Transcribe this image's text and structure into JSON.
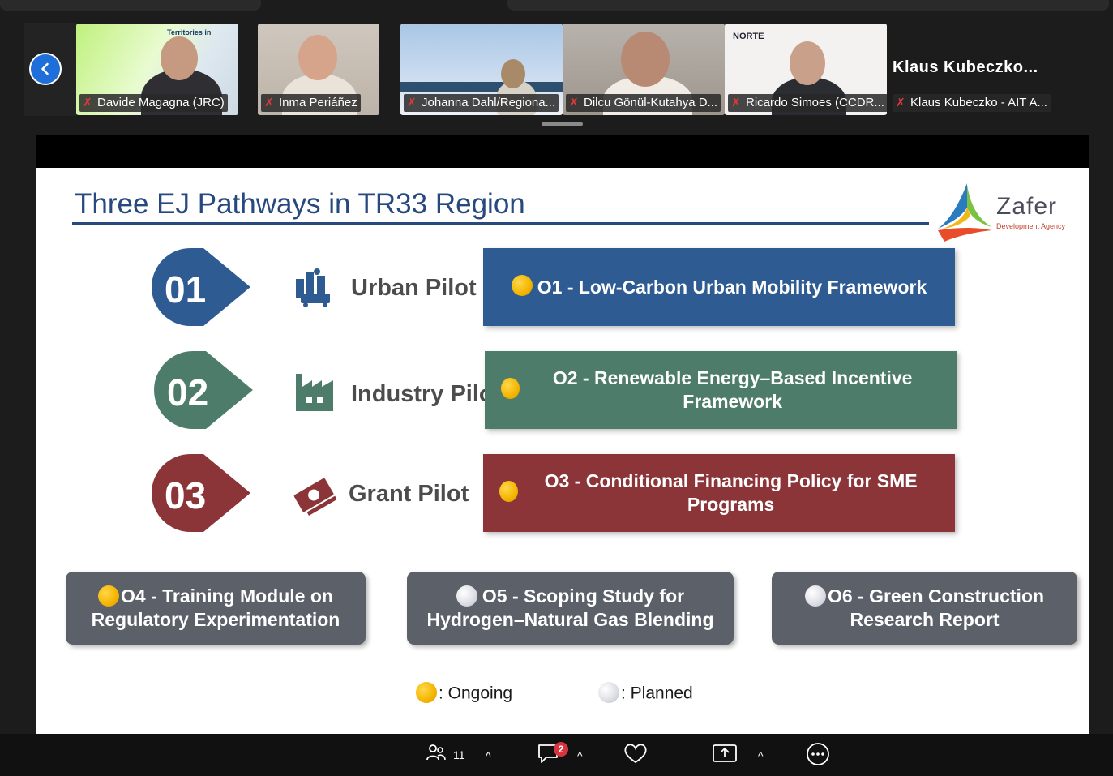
{
  "participants": [
    {
      "name": "Davide Magagna (JRC)",
      "background_text": "Territories in"
    },
    {
      "name": "Inma Periáñez"
    },
    {
      "name": "Johanna Dahl/Regiona..."
    },
    {
      "name": "Dilcu Gönül-Kutahya D..."
    },
    {
      "name": "Ricardo Simoes (CCDR...",
      "logo_text": "NORTE"
    },
    {
      "name": "Klaus Kubeczko - AIT A...",
      "display_name": "Klaus  Kubeczko..."
    }
  ],
  "more_options_label": "...",
  "slide": {
    "title": "Three EJ Pathways in TR33 Region",
    "logo": {
      "name": "Zafer",
      "subtitle": "Development Agency"
    },
    "pilots": [
      {
        "number": "01",
        "label": "Urban Pilot",
        "objective": "O1 - Low-Carbon Urban Mobility Framework",
        "status": "ongoing",
        "color": "#2f5b93"
      },
      {
        "number": "02",
        "label": "Industry Pilot",
        "objective": "O2 - Renewable Energy–Based Incentive Framework",
        "status": "ongoing",
        "color": "#4d7d6a"
      },
      {
        "number": "03",
        "label": "Grant Pilot",
        "objective": "O3 - Conditional Financing Policy for SME Programs",
        "status": "ongoing",
        "color": "#8b3539"
      }
    ],
    "other_objectives": [
      {
        "text": "O4 - Training Module on Regulatory Experimentation",
        "status": "ongoing"
      },
      {
        "text": "O5 - Scoping Study for Hydrogen–Natural Gas Blending",
        "status": "planned"
      },
      {
        "text": "O6 - Green Construction Research Report",
        "status": "planned"
      }
    ],
    "legend": {
      "ongoing": ": Ongoing",
      "planned": ": Planned"
    }
  },
  "toolbar": {
    "participants_count": "11",
    "chat_badge": "2"
  }
}
